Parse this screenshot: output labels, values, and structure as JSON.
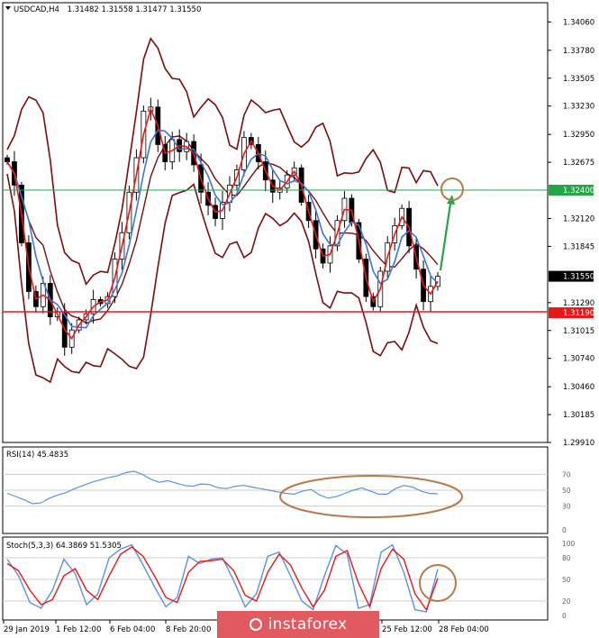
{
  "header": {
    "symbol": "USDCAD,H4",
    "ohlc": "1.31482 1.31558 1.31477 1.31550",
    "arrow_icon": "triangle-down-icon"
  },
  "rsi": {
    "label": "RSI(14) 45.4835",
    "levels": [
      "70",
      "50",
      "30",
      "0"
    ]
  },
  "stoch": {
    "label": "Stoch(5,3,3) 64.3869 51.5305",
    "levels": [
      "100",
      "80",
      "50",
      "20",
      "0"
    ]
  },
  "x_ticks": [
    "29 Jan 2019",
    "1 Feb 12:00",
    "6 Feb 04:00",
    "8 Feb 20:00",
    "25 Feb 12:00",
    "28 Feb 04:00"
  ],
  "brand": "instaforex",
  "colors": {
    "green_line": "#21a845",
    "red_line": "#e81818",
    "bollinger": "#7b0c0c",
    "ma_fast": "#e81818",
    "ma_slow": "#3b76d6",
    "annotation": "#b87a4b"
  },
  "chart_data": {
    "type": "candlestick",
    "symbol": "USDCAD",
    "timeframe": "H4",
    "y_ticks": [
      "1.34060",
      "1.33780",
      "1.33505",
      "1.33230",
      "1.32950",
      "1.32675",
      "1.32120",
      "1.31845",
      "1.31290",
      "1.31015",
      "1.30740",
      "1.30460",
      "1.30185",
      "1.29910"
    ],
    "ylim": [
      1.2991,
      1.3425
    ],
    "horizontal_lines": [
      {
        "name": "resistance",
        "value": 1.324,
        "label": "1.32400",
        "color": "#21a845"
      },
      {
        "name": "support",
        "value": 1.3119,
        "label": "1.31190",
        "color": "#e81818"
      }
    ],
    "current_price": {
      "value": 1.3155,
      "label": "1.31550"
    },
    "close_path": [
      1.3268,
      1.3245,
      1.3188,
      1.314,
      1.3125,
      1.3148,
      1.3115,
      1.312,
      1.3085,
      1.3102,
      1.3112,
      1.3118,
      1.3132,
      1.3128,
      1.3135,
      1.3172,
      1.3198,
      1.3238,
      1.3272,
      1.3318,
      1.3322,
      1.3285,
      1.3268,
      1.329,
      1.3278,
      1.3288,
      1.3265,
      1.3238,
      1.3225,
      1.3212,
      1.3228,
      1.3245,
      1.326,
      1.3292,
      1.3285,
      1.3268,
      1.325,
      1.3238,
      1.3242,
      1.3255,
      1.3262,
      1.3228,
      1.321,
      1.3182,
      1.3168,
      1.3185,
      1.321,
      1.3232,
      1.3208,
      1.3172,
      1.3135,
      1.3125,
      1.316,
      1.3188,
      1.3205,
      1.3222,
      1.3185,
      1.3162,
      1.313,
      1.3145,
      1.3155
    ],
    "rsi_values": [
      46,
      42,
      38,
      33,
      34,
      40,
      44,
      47,
      52,
      56,
      60,
      63,
      66,
      68,
      72,
      74,
      70,
      64,
      60,
      62,
      59,
      56,
      55,
      58,
      57,
      53,
      52,
      55,
      56,
      54,
      52,
      50,
      48,
      46,
      45,
      49,
      51,
      44,
      40,
      42,
      46,
      50,
      53,
      49,
      45,
      45,
      52,
      56,
      54,
      49,
      46,
      45.4835
    ],
    "stoch_main": [
      78,
      55,
      18,
      10,
      35,
      78,
      58,
      15,
      30,
      80,
      92,
      98,
      70,
      40,
      12,
      25,
      82,
      72,
      78,
      80,
      48,
      12,
      30,
      82,
      88,
      55,
      20,
      8,
      55,
      97,
      85,
      10,
      15,
      88,
      98,
      60,
      8,
      5,
      64.3869
    ],
    "stoch_signal": [
      72,
      62,
      35,
      15,
      22,
      55,
      65,
      35,
      22,
      55,
      85,
      95,
      82,
      55,
      25,
      18,
      60,
      75,
      76,
      78,
      62,
      28,
      20,
      60,
      85,
      70,
      38,
      12,
      35,
      82,
      90,
      45,
      12,
      65,
      92,
      78,
      30,
      8,
      51.5305
    ],
    "annotations": [
      {
        "type": "arrow",
        "direction": "up",
        "color": "#21a845"
      },
      {
        "type": "circle",
        "color": "#b87a4b"
      }
    ]
  }
}
